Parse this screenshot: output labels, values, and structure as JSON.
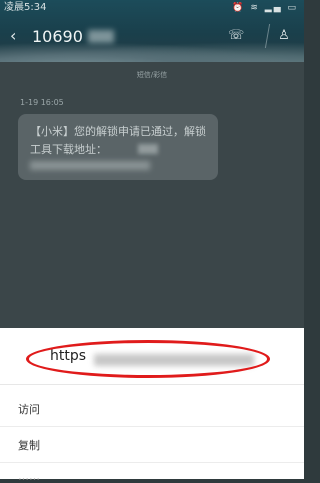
{
  "status_bar": {
    "time": "凌晨5:34",
    "icons": "⏰ ≋ ▂▄ ▭"
  },
  "header": {
    "back_icon": "‹",
    "sender_number": "10690",
    "call_icon": "☏",
    "contact_icon": "♙"
  },
  "messages": {
    "notice": "短信/彩信",
    "timestamp": "1-19 16:05",
    "bubble_line1": "【小米】您的解锁申请已通过，解锁",
    "bubble_line2": "工具下载地址："
  },
  "sheet": {
    "url_text": "https",
    "items": [
      {
        "label": "访问"
      },
      {
        "label": "复制"
      },
      {
        "label": "……"
      }
    ]
  },
  "colors": {
    "highlight": "#e01b1b"
  }
}
